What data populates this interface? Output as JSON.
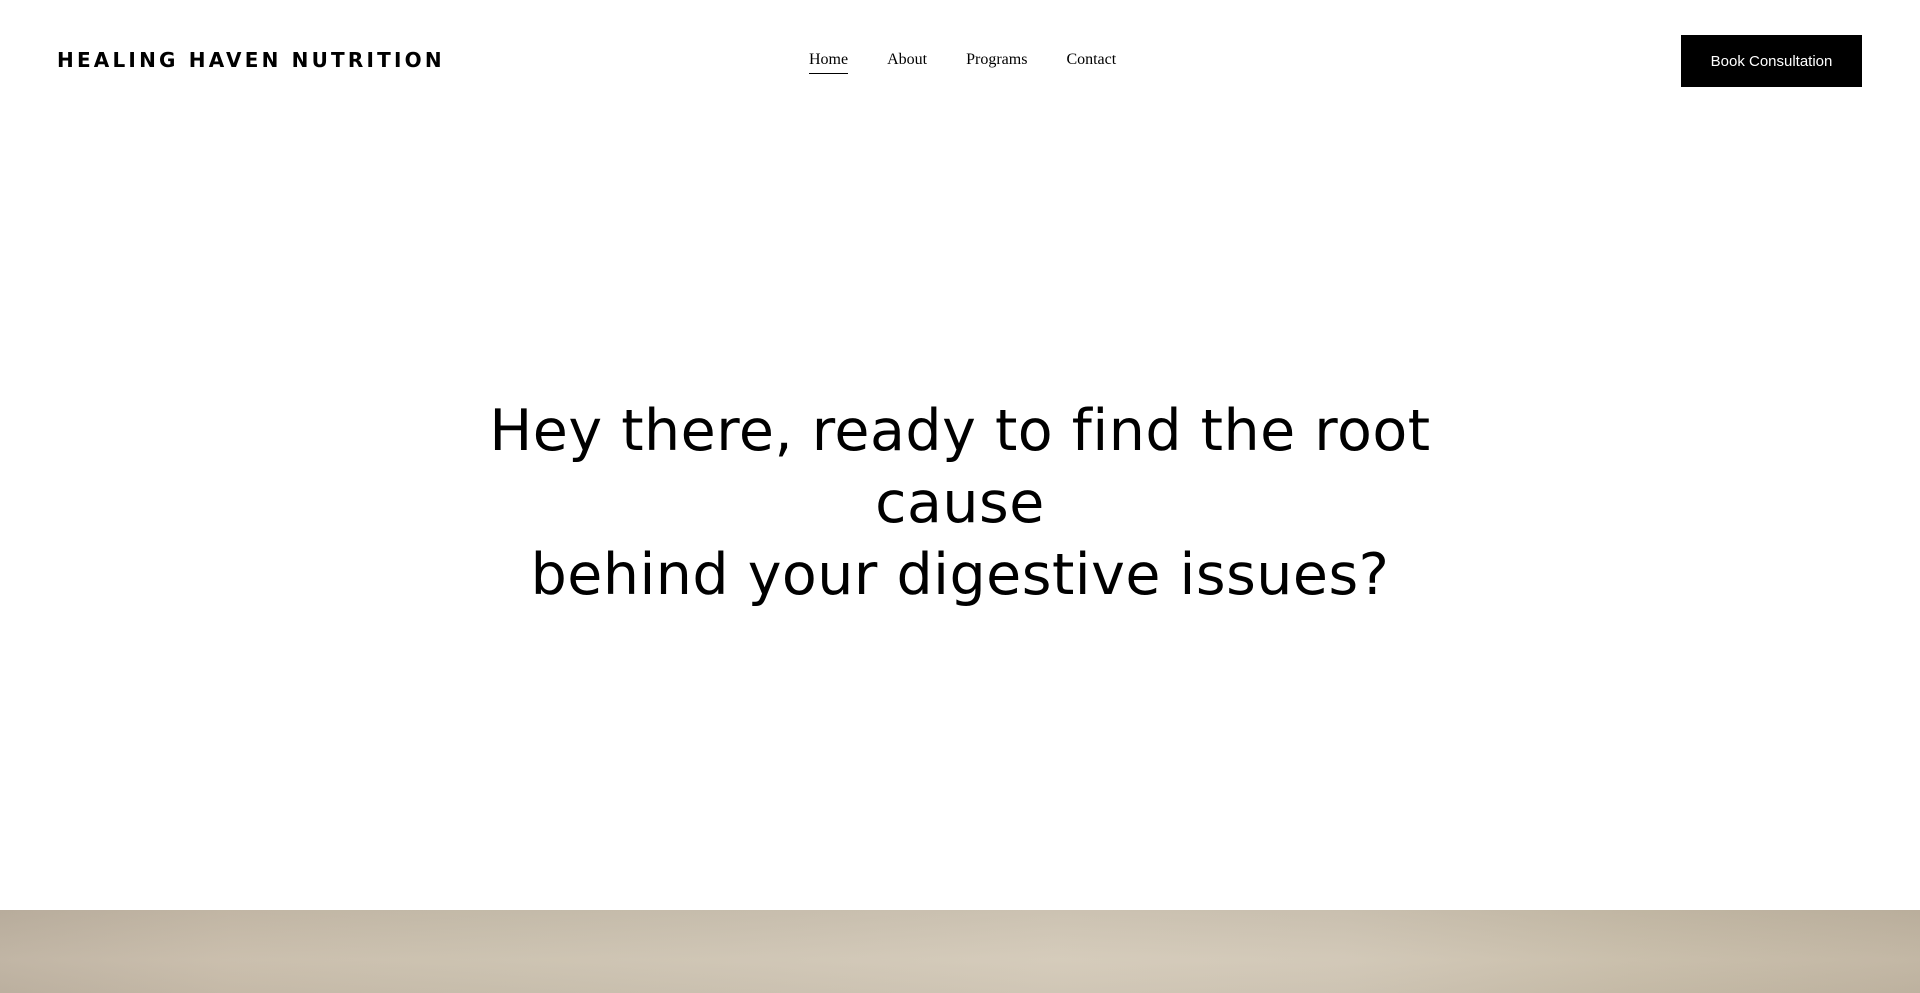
{
  "brand": {
    "name": "HEALING HAVEN NUTRITION"
  },
  "nav": {
    "items": [
      {
        "label": "Home",
        "active": true
      },
      {
        "label": "About",
        "active": false
      },
      {
        "label": "Programs",
        "active": false
      },
      {
        "label": "Contact",
        "active": false
      }
    ]
  },
  "header": {
    "cta_label": "Book Consultation"
  },
  "hero": {
    "title_line1": "Hey there, ready to find the root cause",
    "title_line2": "behind your digestive issues?"
  },
  "colors": {
    "background": "#ffffff",
    "text": "#000000",
    "button_bg": "#000000",
    "button_text": "#ffffff",
    "banner_tone": "#cbc1af"
  }
}
